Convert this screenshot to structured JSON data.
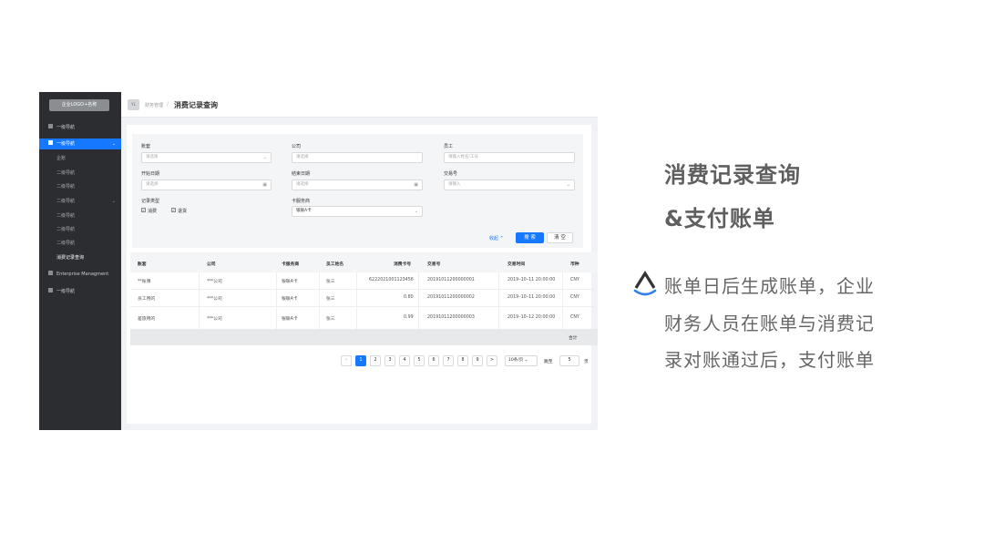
{
  "slide": {
    "title_line1": "消费记录查询",
    "title_line2": "&支付账单",
    "desc_lines": [
      "账单日后生成账单，企业",
      "财务人员在账单与消费记",
      "录对账通过后，支付账单"
    ],
    "brand_icon": "logo-chevron-smile-icon"
  },
  "sidebar": {
    "logo": "企业LOGO+名称",
    "items": [
      {
        "label": "一级导航",
        "icon": "grid-icon"
      },
      {
        "label": "一级导航",
        "icon": "grid-icon",
        "active": true
      },
      {
        "label": "企账"
      },
      {
        "label": "二级导航"
      },
      {
        "label": "二级导航"
      },
      {
        "label": "二级导航"
      },
      {
        "label": "二级导航"
      },
      {
        "label": "二级导航"
      },
      {
        "label": "二级导航"
      },
      {
        "label": "消费记录查询",
        "current": true
      },
      {
        "label": "Enterprise Managment",
        "icon": "grid-icon"
      },
      {
        "label": "一级导航",
        "icon": "grid-icon"
      }
    ]
  },
  "header": {
    "icon_text": "YL",
    "breadcrumb_parent": "财务管理",
    "breadcrumb_sep": "/",
    "page_title": "消费记录查询"
  },
  "filters": {
    "account_label": "账套",
    "account_placeholder": "请选择",
    "company_label": "公司",
    "company_placeholder": "请选择",
    "employee_label": "员工",
    "employee_placeholder": "请输入姓名/工号",
    "start_label": "开始日期",
    "start_placeholder": "请选择",
    "end_label": "结束日期",
    "end_placeholder": "请选择",
    "txn_label": "交易号",
    "txn_placeholder": "请输入",
    "type_label": "记录类型",
    "type_opt1": "消费",
    "type_opt2": "退货",
    "provider_label": "卡服务商",
    "provider_value": "银联A卡",
    "collapse": "收起 ^",
    "search": "搜 索",
    "clear": "清 空"
  },
  "table": {
    "headers": [
      "账套",
      "公司",
      "卡服务商",
      "员工姓名",
      "消费卡号",
      "交易号",
      "交易时间",
      "币种"
    ],
    "rows": [
      [
        "**账簿",
        "***公司",
        "银联A卡",
        "张三",
        "6222021001123456",
        "20191011200000001",
        "2019–10–11 20:00:00",
        "CNY"
      ],
      [
        "员工用的",
        "***公司",
        "银联A卡",
        "张三",
        "0.80",
        "20191011200000002",
        "2019–10–11 20:00:00",
        "CNY"
      ],
      [
        "差旅用的",
        "***公司",
        "银联A卡",
        "张三",
        "0.99",
        "20191011200000003",
        "2019–10–12 20:00:00",
        "CNY"
      ]
    ],
    "footer": "合计"
  },
  "pagination": {
    "prev": "<",
    "pages": [
      "1",
      "2",
      "3",
      "4",
      "5",
      "6",
      "7",
      "8",
      "9"
    ],
    "next": ">",
    "page_size": "10条/页 ⌄",
    "jump_label": "跳至",
    "jump_value": "5",
    "page_unit": "页"
  }
}
